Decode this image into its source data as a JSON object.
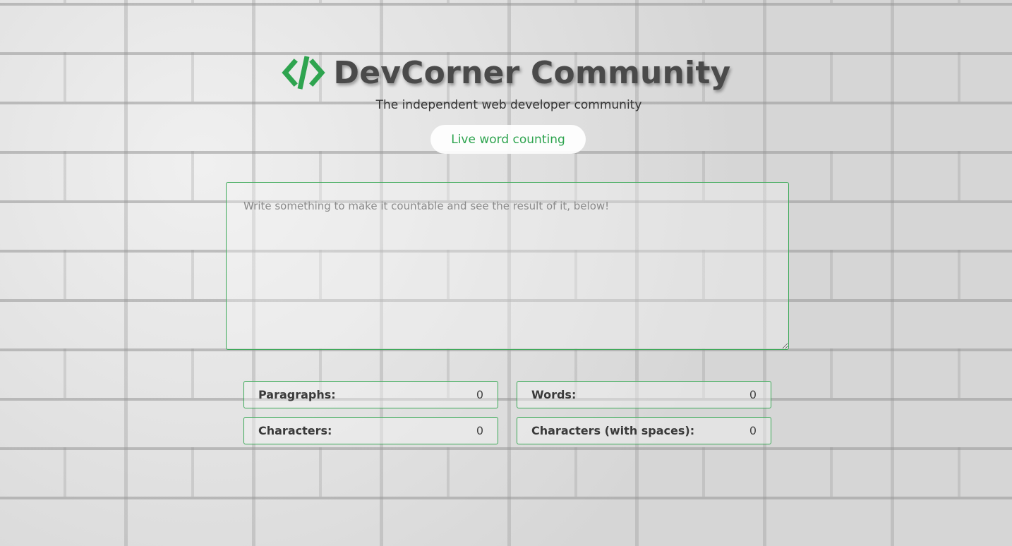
{
  "header": {
    "logo_icon": "code-brackets-icon",
    "title": "DevCorner Community",
    "subtitle": "The independent web developer community"
  },
  "badge": {
    "label": "Live word counting"
  },
  "editor": {
    "value": "",
    "placeholder": "Write something to make it countable and see the result of it, below!"
  },
  "stats": {
    "paragraphs": {
      "label": "Paragraphs:",
      "value": "0"
    },
    "words": {
      "label": "Words:",
      "value": "0"
    },
    "characters": {
      "label": "Characters:",
      "value": "0"
    },
    "characters_spaces": {
      "label": "Characters (with spaces):",
      "value": "0"
    }
  },
  "colors": {
    "accent": "#2ea44f",
    "border": "#3aa856",
    "title": "#4a4a4a"
  }
}
